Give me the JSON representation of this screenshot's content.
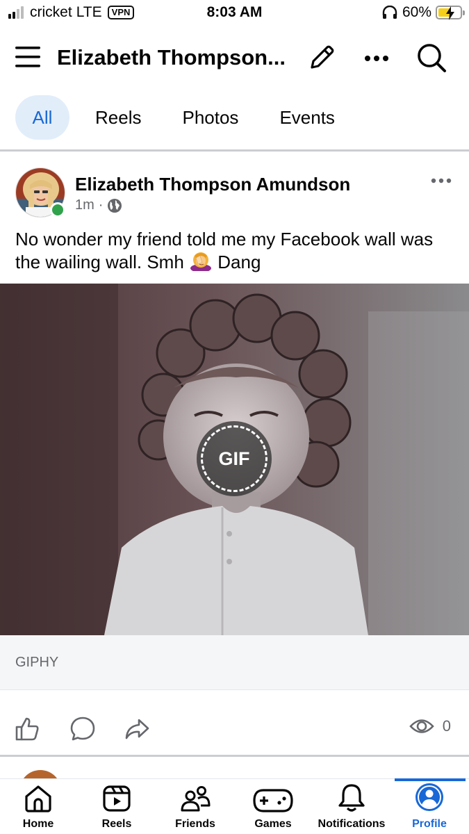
{
  "status_bar": {
    "carrier": "cricket",
    "network": "LTE",
    "vpn": "VPN",
    "time": "8:03 AM",
    "battery": "60%",
    "battery_level": 0.6
  },
  "header": {
    "title": "Elizabeth Thompson...",
    "icons": [
      "menu-icon",
      "edit-icon",
      "more-icon",
      "search-icon"
    ]
  },
  "tabs": [
    {
      "label": "All",
      "active": true
    },
    {
      "label": "Reels",
      "active": false
    },
    {
      "label": "Photos",
      "active": false
    },
    {
      "label": "Events",
      "active": false
    }
  ],
  "post": {
    "author": "Elizabeth Thompson Amundson",
    "time": "1m",
    "separator": "·",
    "privacy_icon": "globe-icon",
    "text_part1": "No wonder my friend told me my Facebook wall was the wailing wall. Smh",
    "emoji": "woman-facepalming",
    "text_part2": "Dang",
    "gif_badge": "GIF",
    "gif_source": "GIPHY",
    "views": "0"
  },
  "actions": [
    "like-icon",
    "comment-icon",
    "share-icon"
  ],
  "bottom_nav": [
    {
      "label": "Home",
      "icon": "home-icon"
    },
    {
      "label": "Reels",
      "icon": "reels-icon"
    },
    {
      "label": "Friends",
      "icon": "friends-icon"
    },
    {
      "label": "Games",
      "icon": "games-icon"
    },
    {
      "label": "Notifications",
      "icon": "bell-icon"
    },
    {
      "label": "Profile",
      "icon": "profile-icon",
      "active": true
    }
  ],
  "colors": {
    "accent": "#1868d6",
    "tab_active_bg": "#e2edfa",
    "online": "#31a24c",
    "muted_text": "#65676b"
  }
}
